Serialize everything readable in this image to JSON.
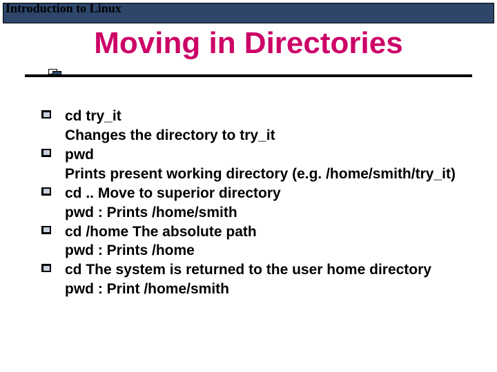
{
  "header": {
    "title": "Introduction to Linux"
  },
  "slide": {
    "title": "Moving in Directories",
    "bullets": [
      {
        "line1": "cd try_it",
        "line2": "Changes the directory to try_it"
      },
      {
        "line1": "pwd",
        "line2": "Prints present working directory (e.g. /home/smith/try_it)"
      },
      {
        "line1": "cd .. Move to superior directory",
        "line2": "pwd : Prints /home/smith"
      },
      {
        "line1": "cd /home The absolute path",
        "line2": "pwd : Prints /home"
      },
      {
        "line1": "cd The system is returned to the user home directory",
        "line2": "pwd : Print /home/smith"
      }
    ]
  }
}
